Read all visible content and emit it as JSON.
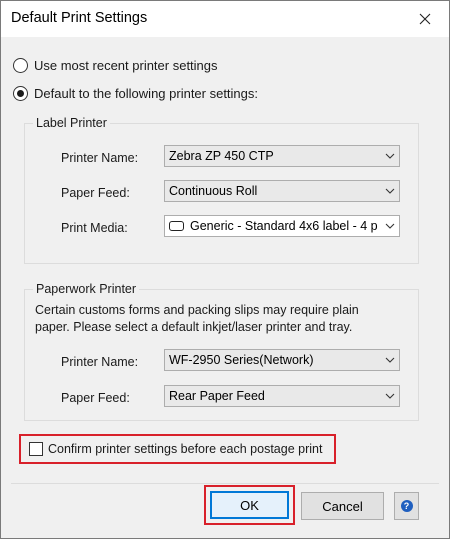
{
  "window": {
    "title": "Default Print Settings"
  },
  "options": {
    "recent_label": "Use most recent printer settings",
    "default_label": "Default to the following printer settings:",
    "selected": "default"
  },
  "label_printer": {
    "legend": "Label Printer",
    "printer_name_label": "Printer Name:",
    "printer_name_value": "Zebra ZP 450 CTP",
    "paper_feed_label": "Paper Feed:",
    "paper_feed_value": "Continuous Roll",
    "print_media_label": "Print Media:",
    "print_media_value": "Generic - Standard 4x6 label - 4 p"
  },
  "paperwork_printer": {
    "legend": "Paperwork Printer",
    "help_line1": "Certain customs forms and packing slips may require plain",
    "help_line2": "paper. Please select a default inkjet/laser printer and tray.",
    "printer_name_label": "Printer Name:",
    "printer_name_value": "WF-2950 Series(Network)",
    "paper_feed_label": "Paper Feed:",
    "paper_feed_value": "Rear Paper Feed"
  },
  "confirm": {
    "label": "Confirm printer settings before each postage print",
    "checked": false
  },
  "buttons": {
    "ok": "OK",
    "cancel": "Cancel",
    "help": "?"
  },
  "colors": {
    "highlight": "#d8202a",
    "focus": "#0078d7",
    "help_icon": "#1f5fbf"
  }
}
